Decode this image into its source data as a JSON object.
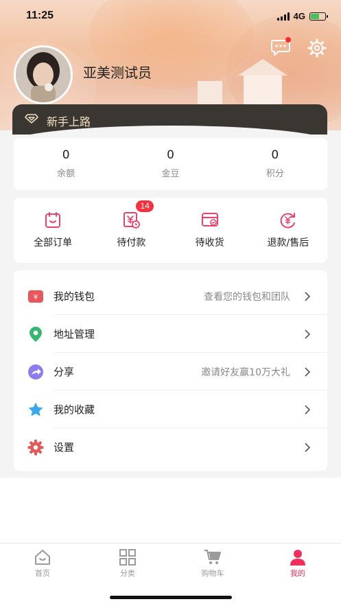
{
  "status_bar": {
    "time": "11:25",
    "network": "4G"
  },
  "header": {
    "username": "亚美测试员",
    "vip_label": "新手上路",
    "icons": {
      "message": "message-icon",
      "settings": "gear-icon"
    },
    "message_dot_color": "#ff2a2a"
  },
  "stats": [
    {
      "value": "0",
      "label": "余额"
    },
    {
      "value": "0",
      "label": "金豆"
    },
    {
      "value": "0",
      "label": "积分"
    }
  ],
  "orders": [
    {
      "label": "全部订单",
      "icon": "order-list-icon"
    },
    {
      "label": "待付款",
      "icon": "pending-payment-icon",
      "badge": "14"
    },
    {
      "label": "待收货",
      "icon": "pending-delivery-icon"
    },
    {
      "label": "退款/售后",
      "icon": "refund-icon"
    }
  ],
  "menu": [
    {
      "label": "我的钱包",
      "hint": "查看您的钱包和团队",
      "icon": "wallet-icon",
      "color": "#e8585b"
    },
    {
      "label": "地址管理",
      "hint": "",
      "icon": "location-icon",
      "color": "#34b76f"
    },
    {
      "label": "分享",
      "hint": "邀请好友赢10万大礼",
      "icon": "share-icon",
      "color": "#8d7bf0"
    },
    {
      "label": "我的收藏",
      "hint": "",
      "icon": "star-icon",
      "color": "#3aa7ec"
    },
    {
      "label": "设置",
      "hint": "",
      "icon": "gear-icon",
      "color": "#e45a5a"
    }
  ],
  "tabbar": [
    {
      "label": "首页",
      "icon": "home-icon",
      "active": false
    },
    {
      "label": "分类",
      "icon": "category-icon",
      "active": false
    },
    {
      "label": "购物车",
      "icon": "cart-icon",
      "active": false
    },
    {
      "label": "我的",
      "icon": "profile-icon",
      "active": true
    }
  ],
  "colors": {
    "accent": "#f0305a",
    "order_icon": "#e8426b",
    "badge": "#f4313f",
    "vip_bar": "#3a3733",
    "vip_text": "#f1dfc2"
  }
}
